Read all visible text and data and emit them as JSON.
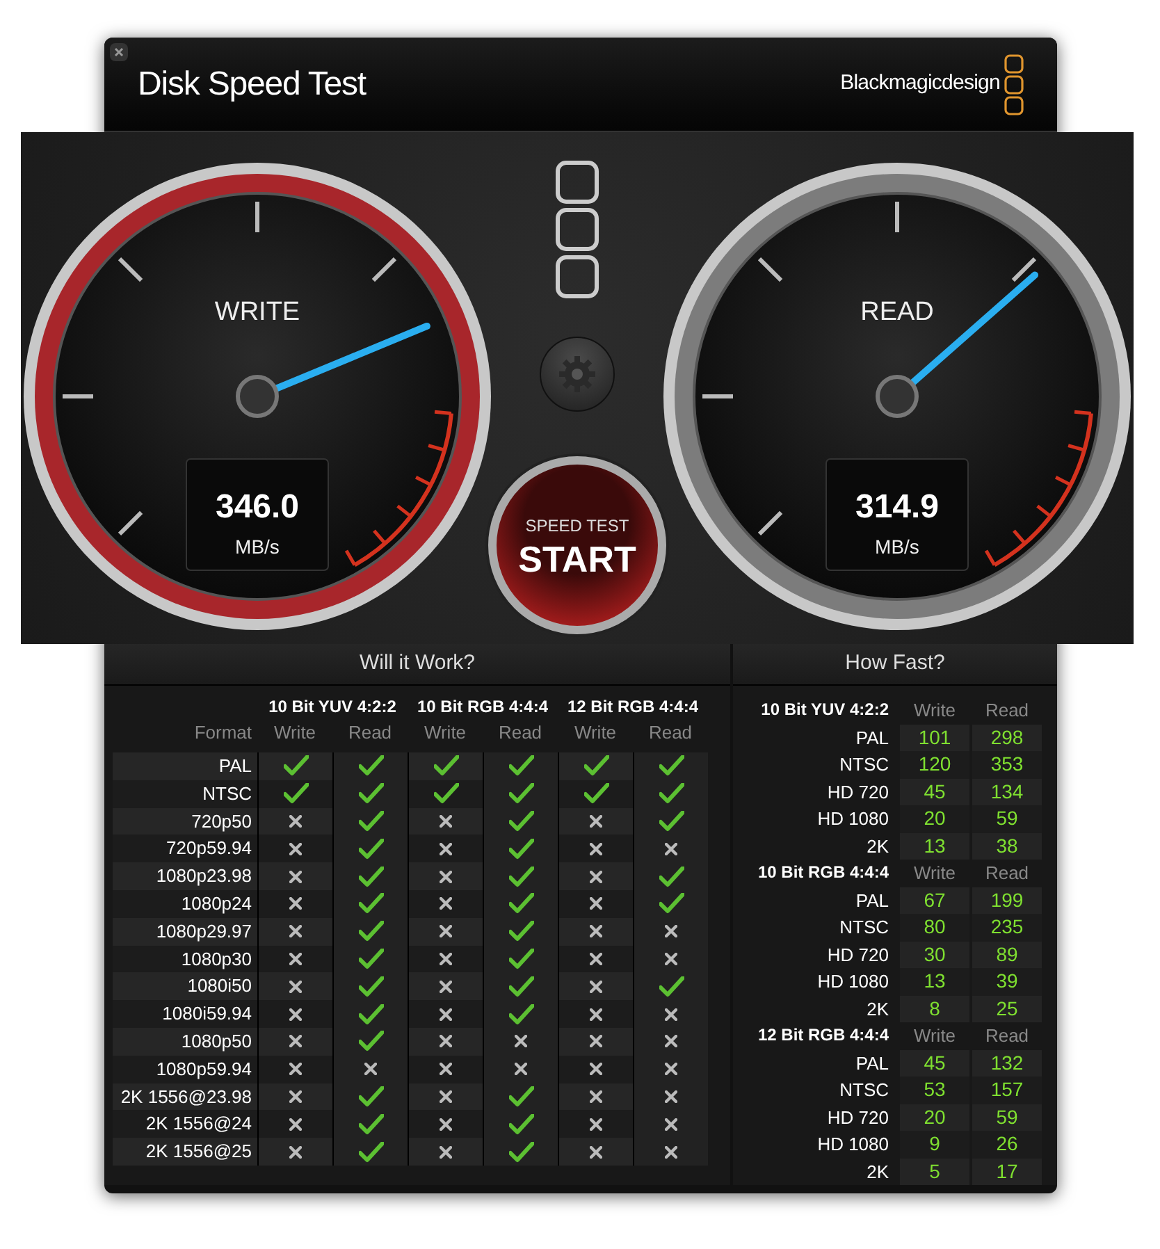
{
  "window": {
    "title": "Disk Speed Test",
    "brand": "Blackmagicdesign"
  },
  "gauges": [
    {
      "label": "WRITE",
      "value": "346.0",
      "unit": "MB/s",
      "level": 0.75,
      "color": "#a8262b"
    },
    {
      "label": "READ",
      "value": "314.9",
      "unit": "MB/s",
      "level": 0.68,
      "color": "#7c7c7c"
    }
  ],
  "start_button": {
    "caption": "SPEED TEST",
    "label": "START"
  },
  "will_it_work": {
    "title": "Will it Work?",
    "format_header": "Format",
    "groups": [
      {
        "name": "10 Bit YUV 4:2:2",
        "columns": [
          "Write",
          "Read"
        ]
      },
      {
        "name": "10 Bit RGB 4:4:4",
        "columns": [
          "Write",
          "Read"
        ]
      },
      {
        "name": "12 Bit RGB 4:4:4",
        "columns": [
          "Write",
          "Read"
        ]
      }
    ],
    "rows": [
      {
        "format": "PAL",
        "results": [
          true,
          true,
          true,
          true,
          true,
          true
        ]
      },
      {
        "format": "NTSC",
        "results": [
          true,
          true,
          true,
          true,
          true,
          true
        ]
      },
      {
        "format": "720p50",
        "results": [
          false,
          true,
          false,
          true,
          false,
          true
        ]
      },
      {
        "format": "720p59.94",
        "results": [
          false,
          true,
          false,
          true,
          false,
          false
        ]
      },
      {
        "format": "1080p23.98",
        "results": [
          false,
          true,
          false,
          true,
          false,
          true
        ]
      },
      {
        "format": "1080p24",
        "results": [
          false,
          true,
          false,
          true,
          false,
          true
        ]
      },
      {
        "format": "1080p29.97",
        "results": [
          false,
          true,
          false,
          true,
          false,
          false
        ]
      },
      {
        "format": "1080p30",
        "results": [
          false,
          true,
          false,
          true,
          false,
          false
        ]
      },
      {
        "format": "1080i50",
        "results": [
          false,
          true,
          false,
          true,
          false,
          true
        ]
      },
      {
        "format": "1080i59.94",
        "results": [
          false,
          true,
          false,
          true,
          false,
          false
        ]
      },
      {
        "format": "1080p50",
        "results": [
          false,
          true,
          false,
          false,
          false,
          false
        ]
      },
      {
        "format": "1080p59.94",
        "results": [
          false,
          false,
          false,
          false,
          false,
          false
        ]
      },
      {
        "format": "2K 1556@23.98",
        "results": [
          false,
          true,
          false,
          true,
          false,
          false
        ]
      },
      {
        "format": "2K 1556@24",
        "results": [
          false,
          true,
          false,
          true,
          false,
          false
        ]
      },
      {
        "format": "2K 1556@25",
        "results": [
          false,
          true,
          false,
          true,
          false,
          false
        ]
      }
    ]
  },
  "how_fast": {
    "title": "How Fast?",
    "sections": [
      {
        "name": "10 Bit YUV 4:2:2",
        "columns": [
          "Write",
          "Read"
        ],
        "rows": [
          {
            "format": "PAL",
            "write": "101",
            "read": "298"
          },
          {
            "format": "NTSC",
            "write": "120",
            "read": "353"
          },
          {
            "format": "HD 720",
            "write": "45",
            "read": "134"
          },
          {
            "format": "HD 1080",
            "write": "20",
            "read": "59"
          },
          {
            "format": "2K",
            "write": "13",
            "read": "38"
          }
        ]
      },
      {
        "name": "10 Bit RGB 4:4:4",
        "columns": [
          "Write",
          "Read"
        ],
        "rows": [
          {
            "format": "PAL",
            "write": "67",
            "read": "199"
          },
          {
            "format": "NTSC",
            "write": "80",
            "read": "235"
          },
          {
            "format": "HD 720",
            "write": "30",
            "read": "89"
          },
          {
            "format": "HD 1080",
            "write": "13",
            "read": "39"
          },
          {
            "format": "2K",
            "write": "8",
            "read": "25"
          }
        ]
      },
      {
        "name": "12 Bit RGB 4:4:4",
        "columns": [
          "Write",
          "Read"
        ],
        "rows": [
          {
            "format": "PAL",
            "write": "45",
            "read": "132"
          },
          {
            "format": "NTSC",
            "write": "53",
            "read": "157"
          },
          {
            "format": "HD 720",
            "write": "20",
            "read": "59"
          },
          {
            "format": "HD 1080",
            "write": "9",
            "read": "26"
          },
          {
            "format": "2K",
            "write": "5",
            "read": "17"
          }
        ]
      }
    ]
  }
}
